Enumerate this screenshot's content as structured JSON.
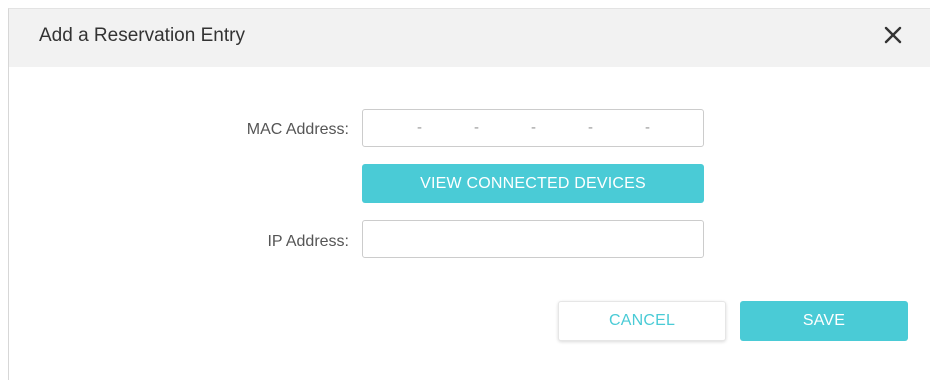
{
  "dialog": {
    "title": "Add a Reservation Entry",
    "close_icon": "close-icon"
  },
  "form": {
    "mac_label": "MAC Address:",
    "mac_separators": [
      "-",
      "-",
      "-",
      "-",
      "-"
    ],
    "view_devices_label": "VIEW CONNECTED DEVICES",
    "ip_label": "IP Address:",
    "ip_value": ""
  },
  "actions": {
    "cancel_label": "CANCEL",
    "save_label": "SAVE"
  },
  "colors": {
    "accent": "#4acbd6",
    "header_bg": "#f2f2f2"
  }
}
